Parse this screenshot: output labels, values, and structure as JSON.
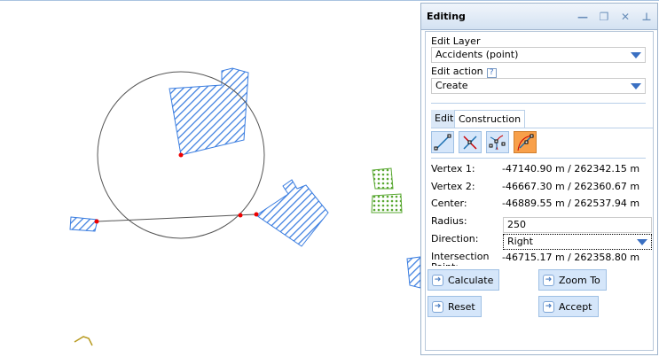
{
  "panel": {
    "title": "Editing",
    "edit_layer_label": "Edit Layer",
    "edit_layer_value": "Accidents (point)",
    "edit_action_label": "Edit action",
    "edit_action_help": "?",
    "edit_action_value": "Create",
    "tabs": [
      "Edit",
      "Construction"
    ],
    "vertex1_label": "Vertex 1:",
    "vertex1_value": "-47140.90 m / 262342.15 m",
    "vertex2_label": "Vertex 2:",
    "vertex2_value": "-46667.30 m / 262360.67 m",
    "center_label": "Center:",
    "center_value": "-46889.55 m / 262537.94 m",
    "radius_label": "Radius:",
    "radius_value": "250",
    "direction_label": "Direction:",
    "direction_value": "Right",
    "intersection_label": "Intersection Point:",
    "intersection_value": "-46715.17 m / 262358.80 m",
    "buttons": {
      "calculate": "Calculate",
      "zoom_to": "Zoom To",
      "reset": "Reset",
      "accept": "Accept"
    }
  }
}
